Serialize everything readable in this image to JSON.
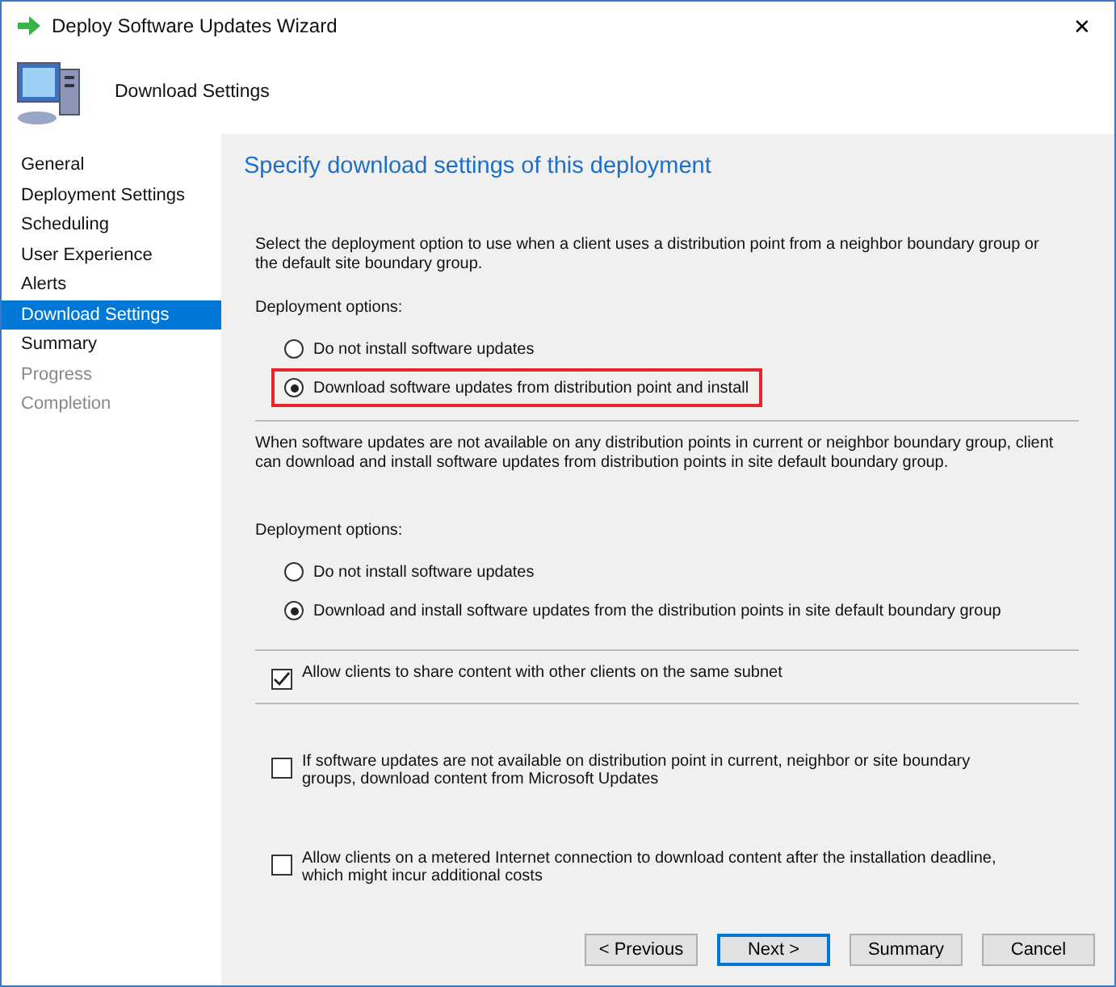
{
  "window": {
    "title": "Deploy Software Updates Wizard",
    "close": "✕"
  },
  "header": {
    "title": "Download Settings"
  },
  "sidebar": {
    "items": [
      {
        "label": "General",
        "selected": false,
        "disabled": false
      },
      {
        "label": "Deployment Settings",
        "selected": false,
        "disabled": false
      },
      {
        "label": "Scheduling",
        "selected": false,
        "disabled": false
      },
      {
        "label": "User Experience",
        "selected": false,
        "disabled": false
      },
      {
        "label": "Alerts",
        "selected": false,
        "disabled": false
      },
      {
        "label": "Download Settings",
        "selected": true,
        "disabled": false
      },
      {
        "label": "Summary",
        "selected": false,
        "disabled": false
      },
      {
        "label": "Progress",
        "selected": false,
        "disabled": true
      },
      {
        "label": "Completion",
        "selected": false,
        "disabled": true
      }
    ]
  },
  "content": {
    "heading": "Specify download settings of this deployment",
    "sections": [
      {
        "kind": "radios",
        "intro": "Select the deployment option to use when a client uses a distribution point from a neighbor boundary group or the default site boundary group.",
        "label": "Deployment options:",
        "options": [
          {
            "label": "Do not install software updates",
            "selected": false,
            "highlighted": false
          },
          {
            "label": "Download software updates from distribution point and install",
            "selected": true,
            "highlighted": true
          }
        ]
      },
      {
        "kind": "radios",
        "intro": "When software updates are not available on any distribution points in current or neighbor boundary group, client can download and install software updates from distribution points in site default boundary group.",
        "label": "Deployment options:",
        "options": [
          {
            "label": "Do not install software updates",
            "selected": false,
            "highlighted": false
          },
          {
            "label": "Download and install software updates from the distribution points in site default boundary group",
            "selected": true,
            "highlighted": false
          }
        ]
      },
      {
        "kind": "checkbox",
        "label": "Allow clients to share content with other clients on the same subnet",
        "checked": true
      },
      {
        "kind": "checkbox",
        "label": "If software updates are not available on distribution point in current, neighbor or site boundary groups, download content from Microsoft Updates",
        "checked": false
      },
      {
        "kind": "checkbox",
        "label": "Allow clients on a metered Internet connection to download content after the installation deadline, which might incur additional costs",
        "checked": false
      }
    ]
  },
  "buttons": [
    {
      "label": "< Previous",
      "default": false
    },
    {
      "label": "Next >",
      "default": true
    },
    {
      "label": "Summary",
      "default": false
    },
    {
      "label": "Cancel",
      "default": false
    }
  ]
}
